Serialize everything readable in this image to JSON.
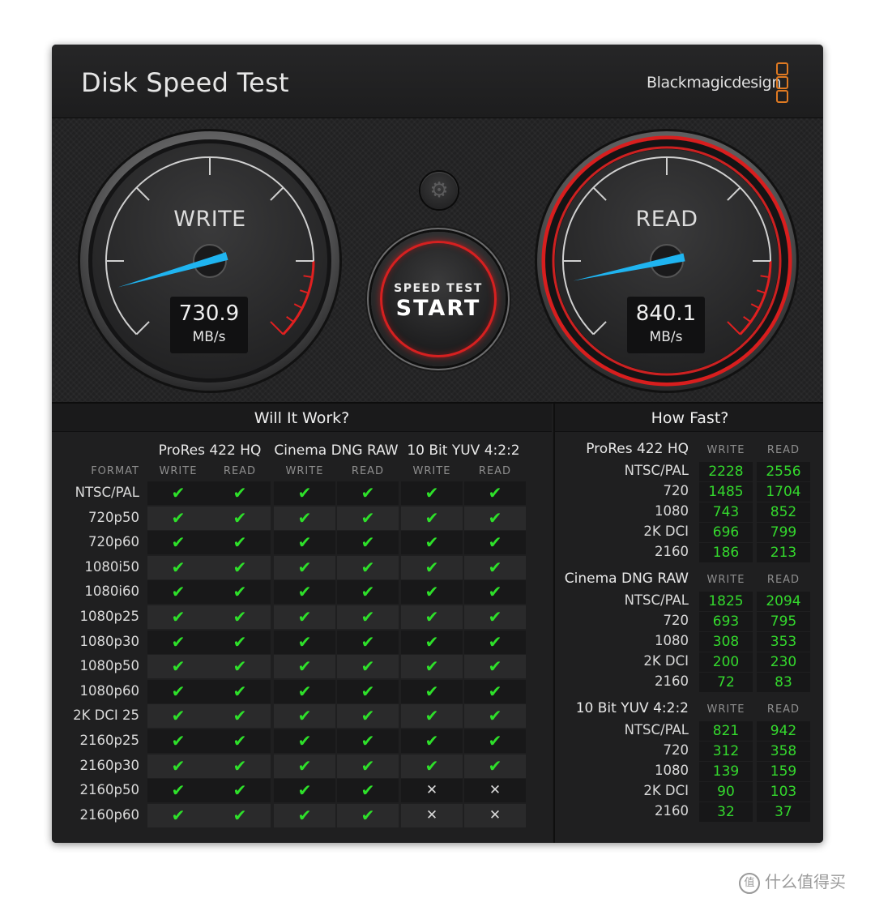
{
  "window": {
    "title": "Disk Speed Test",
    "brand": "Blackmagicdesign",
    "close_glyph": "✕"
  },
  "write_gauge": {
    "label": "WRITE",
    "value": "730.9",
    "unit": "MB/s"
  },
  "read_gauge": {
    "label": "READ",
    "value": "840.1",
    "unit": "MB/s"
  },
  "settings": {
    "icon": "gear-icon",
    "glyph": "⚙"
  },
  "start_button": {
    "small_label": "SPEED TEST",
    "big_label": "START"
  },
  "will_it_work": {
    "title": "Will It Work?",
    "format_header": "FORMAT",
    "groups": [
      "ProRes 422 HQ",
      "Cinema DNG RAW",
      "10 Bit YUV 4:2:2"
    ],
    "sub_headers": [
      "WRITE",
      "READ",
      "WRITE",
      "READ",
      "WRITE",
      "READ"
    ],
    "rows": [
      {
        "format": "NTSC/PAL",
        "marks": [
          "ok",
          "ok",
          "ok",
          "ok",
          "ok",
          "ok"
        ]
      },
      {
        "format": "720p50",
        "marks": [
          "ok",
          "ok",
          "ok",
          "ok",
          "ok",
          "ok"
        ]
      },
      {
        "format": "720p60",
        "marks": [
          "ok",
          "ok",
          "ok",
          "ok",
          "ok",
          "ok"
        ]
      },
      {
        "format": "1080i50",
        "marks": [
          "ok",
          "ok",
          "ok",
          "ok",
          "ok",
          "ok"
        ]
      },
      {
        "format": "1080i60",
        "marks": [
          "ok",
          "ok",
          "ok",
          "ok",
          "ok",
          "ok"
        ]
      },
      {
        "format": "1080p25",
        "marks": [
          "ok",
          "ok",
          "ok",
          "ok",
          "ok",
          "ok"
        ]
      },
      {
        "format": "1080p30",
        "marks": [
          "ok",
          "ok",
          "ok",
          "ok",
          "ok",
          "ok"
        ]
      },
      {
        "format": "1080p50",
        "marks": [
          "ok",
          "ok",
          "ok",
          "ok",
          "ok",
          "ok"
        ]
      },
      {
        "format": "1080p60",
        "marks": [
          "ok",
          "ok",
          "ok",
          "ok",
          "ok",
          "ok"
        ]
      },
      {
        "format": "2K DCI 25",
        "marks": [
          "ok",
          "ok",
          "ok",
          "ok",
          "ok",
          "ok"
        ]
      },
      {
        "format": "2160p25",
        "marks": [
          "ok",
          "ok",
          "ok",
          "ok",
          "ok",
          "ok"
        ]
      },
      {
        "format": "2160p30",
        "marks": [
          "ok",
          "ok",
          "ok",
          "ok",
          "ok",
          "ok"
        ]
      },
      {
        "format": "2160p50",
        "marks": [
          "ok",
          "ok",
          "ok",
          "ok",
          "no",
          "no"
        ]
      },
      {
        "format": "2160p60",
        "marks": [
          "ok",
          "ok",
          "ok",
          "ok",
          "no",
          "no"
        ]
      }
    ],
    "ok_glyph": "✔",
    "no_glyph": "✕"
  },
  "how_fast": {
    "title": "How Fast?",
    "write_header": "WRITE",
    "read_header": "READ",
    "groups": [
      {
        "name": "ProRes 422 HQ",
        "rows": [
          {
            "label": "NTSC/PAL",
            "write": "2228",
            "read": "2556"
          },
          {
            "label": "720",
            "write": "1485",
            "read": "1704"
          },
          {
            "label": "1080",
            "write": "743",
            "read": "852"
          },
          {
            "label": "2K DCI",
            "write": "696",
            "read": "799"
          },
          {
            "label": "2160",
            "write": "186",
            "read": "213"
          }
        ]
      },
      {
        "name": "Cinema DNG RAW",
        "rows": [
          {
            "label": "NTSC/PAL",
            "write": "1825",
            "read": "2094"
          },
          {
            "label": "720",
            "write": "693",
            "read": "795"
          },
          {
            "label": "1080",
            "write": "308",
            "read": "353"
          },
          {
            "label": "2K DCI",
            "write": "200",
            "read": "230"
          },
          {
            "label": "2160",
            "write": "72",
            "read": "83"
          }
        ]
      },
      {
        "name": "10 Bit YUV 4:2:2",
        "rows": [
          {
            "label": "NTSC/PAL",
            "write": "821",
            "read": "942"
          },
          {
            "label": "720",
            "write": "312",
            "read": "358"
          },
          {
            "label": "1080",
            "write": "139",
            "read": "159"
          },
          {
            "label": "2K DCI",
            "write": "90",
            "read": "103"
          },
          {
            "label": "2160",
            "write": "32",
            "read": "37"
          }
        ]
      }
    ]
  },
  "watermark": {
    "icon": "值",
    "text": "什么值得买"
  },
  "colors": {
    "accent_red": "#d62020",
    "needle_blue": "#1fb4f0",
    "ok_green": "#2ee02a",
    "brand_orange": "#e07a22"
  }
}
